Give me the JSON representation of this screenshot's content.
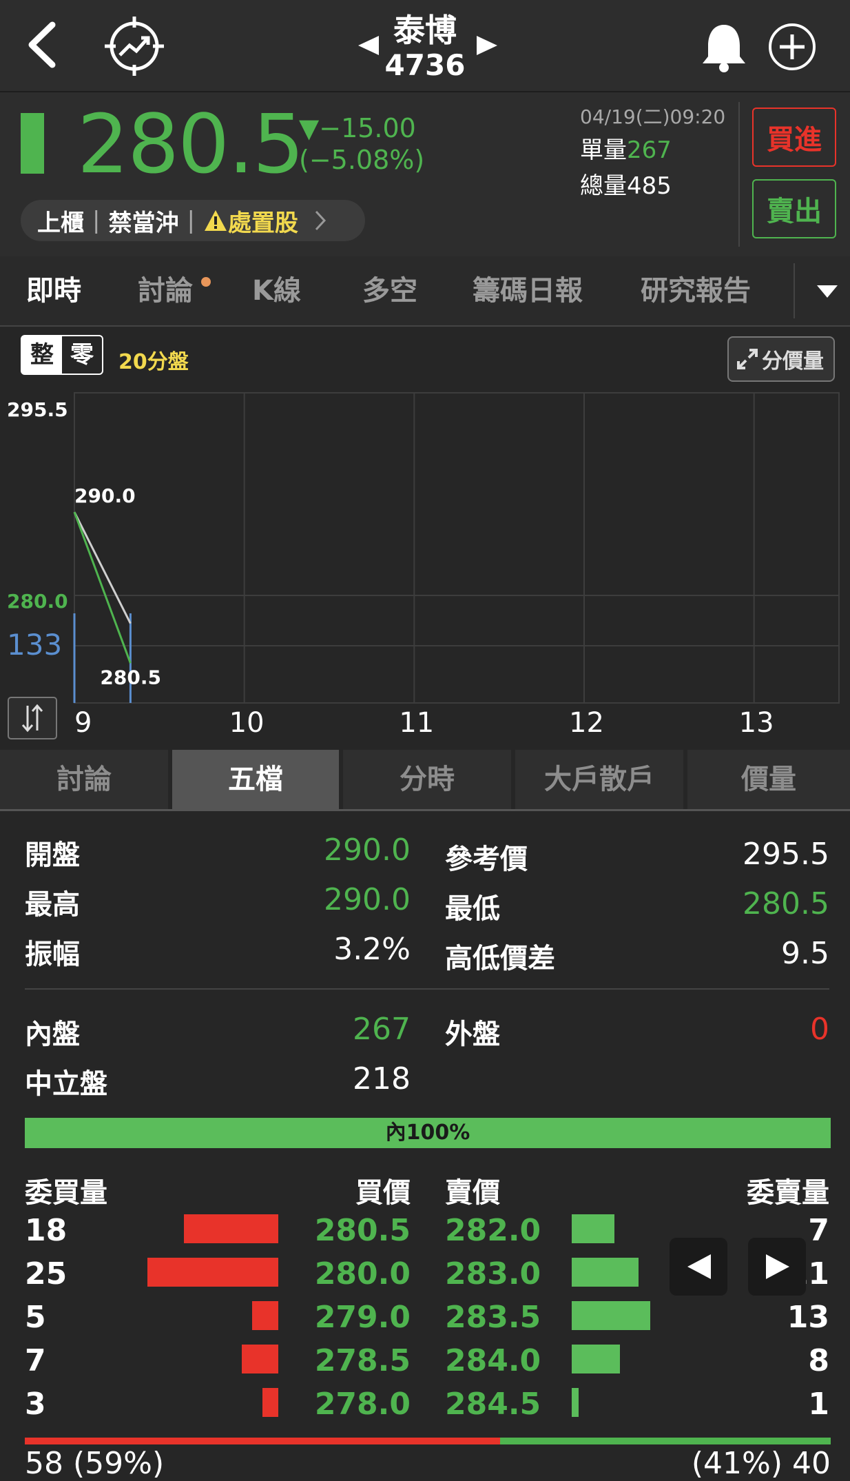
{
  "header": {
    "name": "泰博",
    "code": "4736"
  },
  "quote": {
    "price": "280.5",
    "change": "▼−15.00",
    "change_pct": "(−5.08%)",
    "datetime": "04/19(二)09:20",
    "single_vol_label": "單量",
    "single_vol": "267",
    "total_vol_label": "總量",
    "total_vol": "485",
    "buy_label": "買進",
    "sell_label": "賣出",
    "tags": [
      "上櫃",
      "禁當沖",
      "處置股"
    ],
    "colors": {
      "down": "#4fb44f",
      "up": "#e8332a"
    }
  },
  "tabs": [
    "即時",
    "討論",
    "K線",
    "多空",
    "籌碼日報",
    "研究報告"
  ],
  "chart_controls": {
    "whole": "整",
    "odd": "零",
    "period": "20分盤",
    "price_vol": "分價量"
  },
  "chart_data": {
    "type": "line",
    "x_ticks": [
      "9",
      "10",
      "11",
      "12",
      "13"
    ],
    "ref_price_label": "295.5",
    "low_label": "280.0",
    "volume_label": "133",
    "series": [
      {
        "color": "#4fb44f",
        "x": [
          9.0,
          9.33
        ],
        "y": [
          290.0,
          280.5
        ]
      },
      {
        "color": "#cfcfcf",
        "x": [
          9.0,
          9.33
        ],
        "y": [
          290.0,
          283.0
        ]
      }
    ],
    "volume": {
      "x": [
        9.0,
        9.33
      ],
      "v": [
        133,
        133
      ]
    },
    "annotations": [
      "290.0",
      "280.5"
    ],
    "ylim": [
      278.0,
      297.5
    ],
    "xlim": [
      9,
      13.5
    ]
  },
  "sub_tabs": [
    "討論",
    "五檔",
    "分時",
    "大戶散戶",
    "價量"
  ],
  "stats": {
    "open_label": "開盤",
    "open": "290.0",
    "ref_label": "參考價",
    "ref": "295.5",
    "high_label": "最高",
    "high": "290.0",
    "low_label": "最低",
    "low": "280.5",
    "amp_label": "振幅",
    "amp": "3.2%",
    "spread_label": "高低價差",
    "spread": "9.5",
    "inner_label": "內盤",
    "inner": "267",
    "outer_label": "外盤",
    "outer": "0",
    "neutral_label": "中立盤",
    "neutral": "218",
    "inner_bar": "內100%"
  },
  "orderbook": {
    "headers": {
      "bid_vol": "委買量",
      "bid": "買價",
      "ask": "賣價",
      "ask_vol": "委賣量"
    },
    "bids": [
      {
        "vol": "18",
        "price": "280.5",
        "n": 18
      },
      {
        "vol": "25",
        "price": "280.0",
        "n": 25
      },
      {
        "vol": "5",
        "price": "279.0",
        "n": 5
      },
      {
        "vol": "7",
        "price": "278.5",
        "n": 7
      },
      {
        "vol": "3",
        "price": "278.0",
        "n": 3
      }
    ],
    "asks": [
      {
        "price": "282.0",
        "vol": "7",
        "n": 7
      },
      {
        "price": "283.0",
        "vol": "11",
        "n": 11
      },
      {
        "price": "283.5",
        "vol": "13",
        "n": 13
      },
      {
        "price": "284.0",
        "vol": "8",
        "n": 8
      },
      {
        "price": "284.5",
        "vol": "1",
        "n": 1
      }
    ],
    "bid_total": "58 (59%)",
    "ask_total": "(41%) 40",
    "bid_ratio": 0.59
  }
}
